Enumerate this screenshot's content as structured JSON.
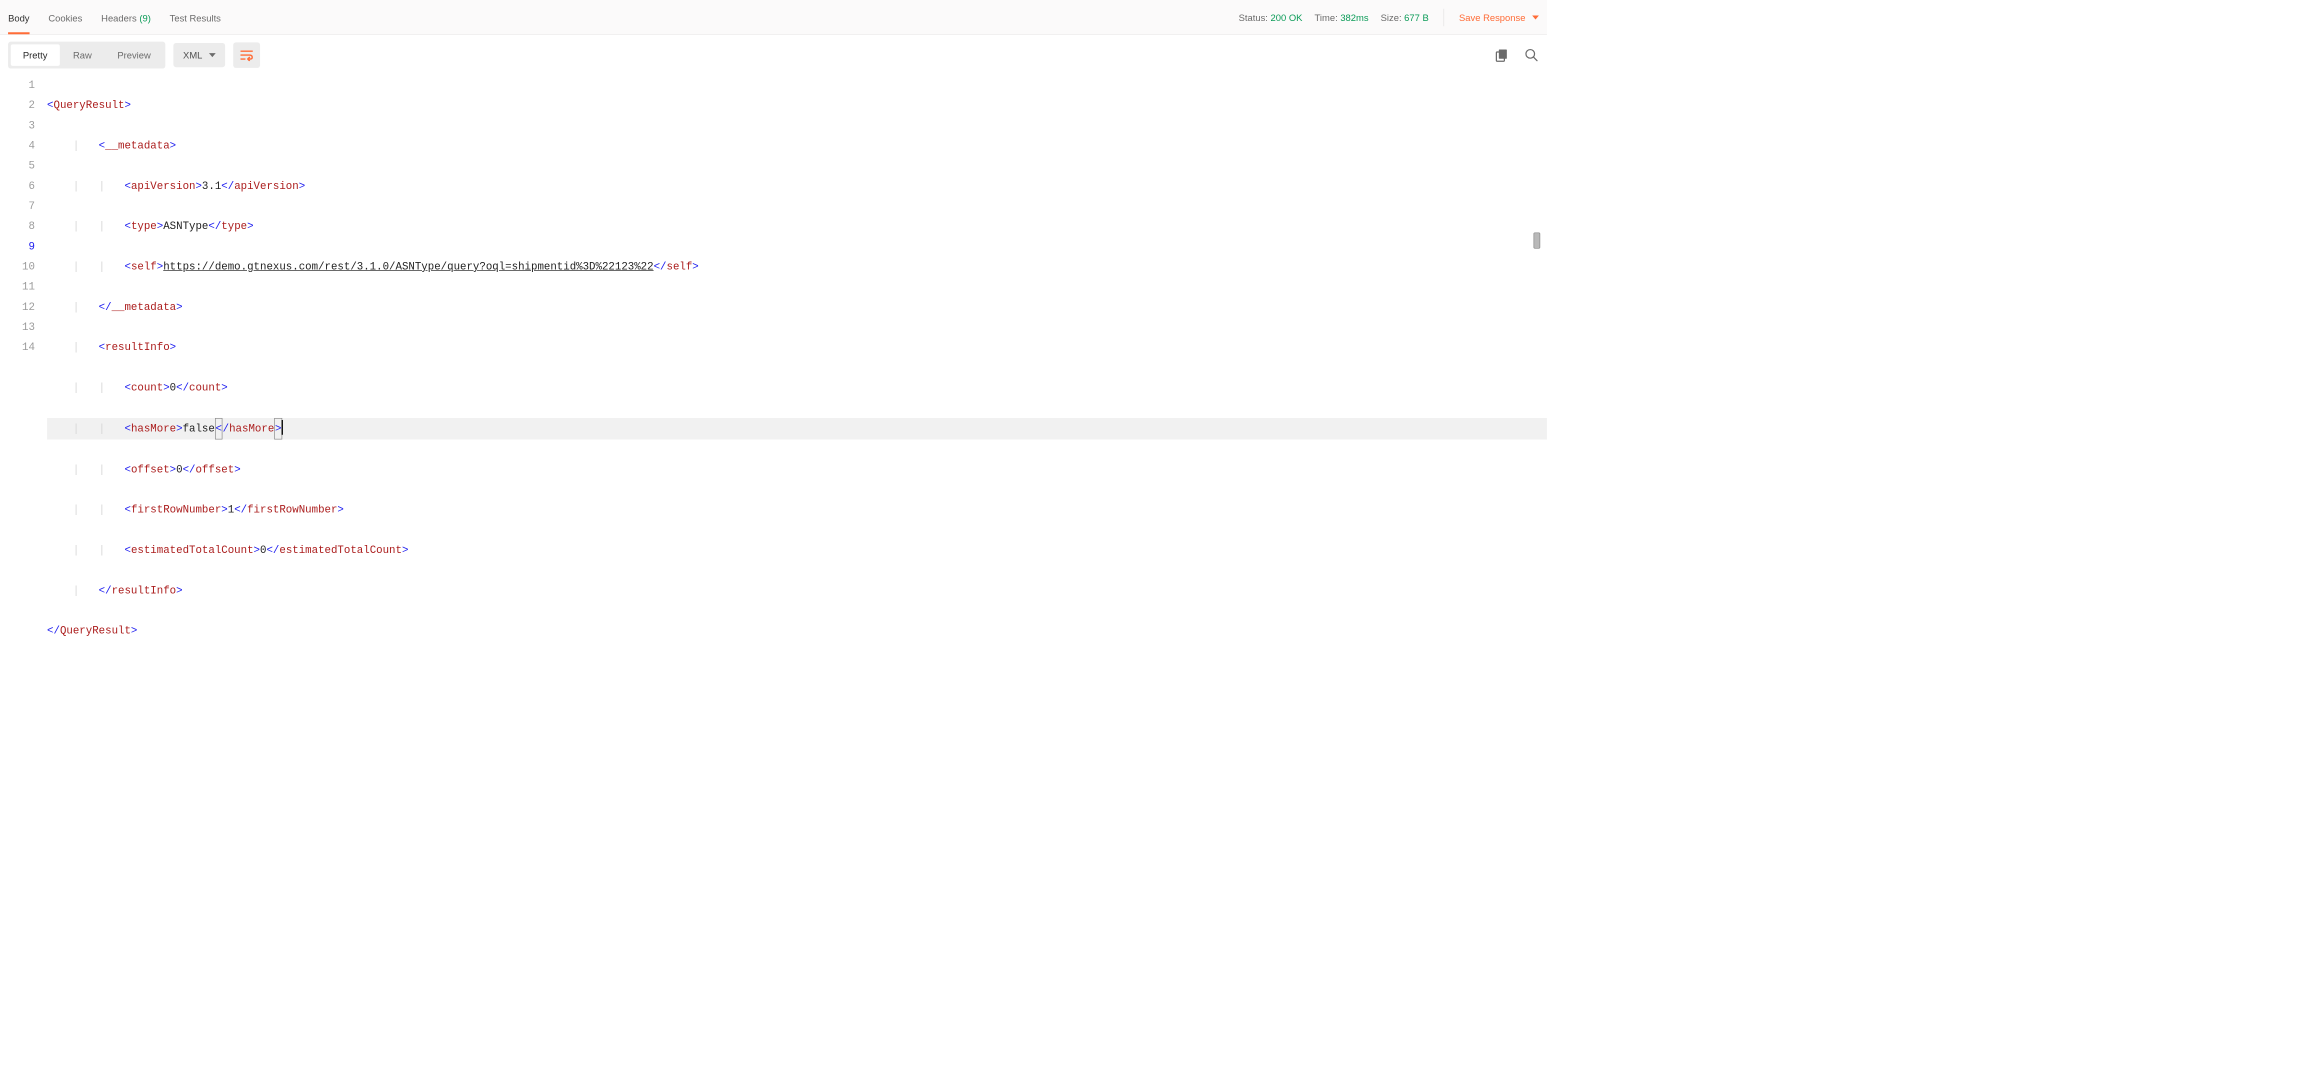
{
  "tabs": {
    "body": "Body",
    "cookies": "Cookies",
    "headers": "Headers",
    "headers_count": "(9)",
    "tests": "Test Results"
  },
  "status": {
    "status_label": "Status:",
    "status_val": "200 OK",
    "time_label": "Time:",
    "time_val": "382ms",
    "size_label": "Size:",
    "size_val": "677 B"
  },
  "save": "Save Response",
  "view": {
    "pretty": "Pretty",
    "raw": "Raw",
    "preview": "Preview",
    "lang": "XML"
  },
  "lines": [
    "1",
    "2",
    "3",
    "4",
    "5",
    "6",
    "7",
    "8",
    "9",
    "10",
    "11",
    "12",
    "13",
    "14"
  ],
  "xml": {
    "q_open": "QueryResult",
    "meta_open": "__metadata",
    "apiV_tag": "apiVersion",
    "apiV_val": "3.1",
    "type_tag": "type",
    "type_val": "ASNType",
    "self_tag": "self",
    "self_val": "https://demo.gtnexus.com/rest/3.1.0/ASNType/query?oql=shipmentid%3D%22123%22",
    "result_tag": "resultInfo",
    "count_tag": "count",
    "count_val": "0",
    "hasmore_tag": "hasMore",
    "hasmore_val": "false",
    "offset_tag": "offset",
    "offset_val": "0",
    "frn_tag": "firstRowNumber",
    "frn_val": "1",
    "etc_tag": "estimatedTotalCount",
    "etc_val": "0"
  }
}
